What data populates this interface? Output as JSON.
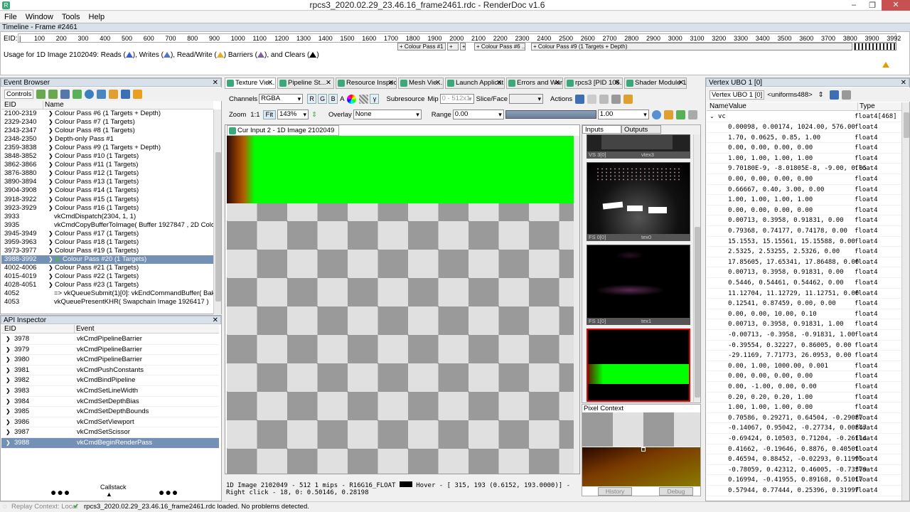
{
  "window": {
    "title": "rpcs3_2020.02.29_23.46.16_frame2461.rdc - RenderDoc v1.6",
    "min": "–",
    "max": "❐",
    "close": "✕"
  },
  "menu": [
    "File",
    "Window",
    "Tools",
    "Help"
  ],
  "timeline": {
    "title": "Timeline - Frame #2461",
    "eid_label": "EID:",
    "ticks": [
      "100",
      "200",
      "300",
      "400",
      "500",
      "600",
      "700",
      "800",
      "900",
      "1000",
      "1100",
      "1200",
      "1300",
      "1400",
      "1500",
      "1600",
      "1700",
      "1800",
      "1900",
      "2000",
      "2100",
      "2200",
      "2300",
      "2400",
      "2500",
      "2600",
      "2700",
      "2800",
      "2900",
      "3000",
      "3100",
      "3200",
      "3300",
      "3400",
      "3500",
      "3600",
      "3700",
      "3800",
      "3900",
      "3992"
    ],
    "passes": [
      "+ Colour Pass #1 ...",
      "+",
      "+",
      "+ Colour Pass #6 ...",
      "+ Colour Pass #9 (1 Targets + Depth)"
    ],
    "usage": {
      "prefix": "Usage for 1D Image 2102049: Reads (",
      "writes": "), Writes (",
      "rw": "), Read/Write (",
      "barriers": ") Barriers (",
      "clears": "), and Clears (",
      "end": ")"
    }
  },
  "event_browser": {
    "title": "Event Browser",
    "controls": "Controls",
    "col_eid": "EID",
    "col_name": "Name",
    "rows": [
      {
        "eid": "2100-2319",
        "name": "Colour Pass #6 (1 Targets + Depth)",
        "arrow": true
      },
      {
        "eid": "2329-2340",
        "name": "Colour Pass #7 (1 Targets)",
        "arrow": true
      },
      {
        "eid": "2343-2347",
        "name": "Colour Pass #8 (1 Targets)",
        "arrow": true
      },
      {
        "eid": "2348-2350",
        "name": "Depth-only Pass #1",
        "arrow": true
      },
      {
        "eid": "2359-3838",
        "name": "Colour Pass #9 (1 Targets + Depth)",
        "arrow": true
      },
      {
        "eid": "3848-3852",
        "name": "Colour Pass #10 (1 Targets)",
        "arrow": true
      },
      {
        "eid": "3862-3866",
        "name": "Colour Pass #11 (1 Targets)",
        "arrow": true
      },
      {
        "eid": "3876-3880",
        "name": "Colour Pass #12 (1 Targets)",
        "arrow": true
      },
      {
        "eid": "3890-3894",
        "name": "Colour Pass #13 (1 Targets)",
        "arrow": true
      },
      {
        "eid": "3904-3908",
        "name": "Colour Pass #14 (1 Targets)",
        "arrow": true
      },
      {
        "eid": "3918-3922",
        "name": "Colour Pass #15 (1 Targets)",
        "arrow": true
      },
      {
        "eid": "3923-3929",
        "name": "Colour Pass #16 (1 Targets)",
        "arrow": true
      },
      {
        "eid": "3933",
        "name": "vkCmdDispatch(2304, 1, 1)",
        "arrow": false
      },
      {
        "eid": "3935",
        "name": "vkCmdCopyBufferToImage( Buffer 1927847 , 2D Color Att",
        "arrow": false
      },
      {
        "eid": "3945-3949",
        "name": "Colour Pass #17 (1 Targets)",
        "arrow": true
      },
      {
        "eid": "3959-3963",
        "name": "Colour Pass #18 (1 Targets)",
        "arrow": true
      },
      {
        "eid": "3973-3977",
        "name": "Colour Pass #19 (1 Targets)",
        "arrow": true
      },
      {
        "eid": "3988-3992",
        "name": "Colour Pass #20 (1 Targets)",
        "arrow": true,
        "selected": true
      },
      {
        "eid": "4002-4006",
        "name": "Colour Pass #21 (1 Targets)",
        "arrow": true
      },
      {
        "eid": "4015-4019",
        "name": "Colour Pass #22 (1 Targets)",
        "arrow": true
      },
      {
        "eid": "4028-4051",
        "name": "Colour Pass #23 (1 Targets)",
        "arrow": true
      },
      {
        "eid": "4052",
        "name": "=> vkQueueSubmit(1)[0]: vkEndCommandBuffer( Baked Comm",
        "arrow": false
      },
      {
        "eid": "4053",
        "name": "vkQueuePresentKHR( Swapchain Image 1926417 )",
        "arrow": false
      }
    ]
  },
  "api_inspector": {
    "title": "API Inspector",
    "col_eid": "EID",
    "col_event": "Event",
    "callstack": "Callstack",
    "rows": [
      {
        "eid": "3978",
        "event": "vkCmdPipelineBarrier"
      },
      {
        "eid": "3979",
        "event": "vkCmdPipelineBarrier"
      },
      {
        "eid": "3980",
        "event": "vkCmdPipelineBarrier"
      },
      {
        "eid": "3981",
        "event": "vkCmdPushConstants"
      },
      {
        "eid": "3982",
        "event": "vkCmdBindPipeline"
      },
      {
        "eid": "3983",
        "event": "vkCmdSetLineWidth"
      },
      {
        "eid": "3984",
        "event": "vkCmdSetDepthBias"
      },
      {
        "eid": "3985",
        "event": "vkCmdSetDepthBounds"
      },
      {
        "eid": "3986",
        "event": "vkCmdSetViewport"
      },
      {
        "eid": "3987",
        "event": "vkCmdSetScissor"
      },
      {
        "eid": "3988",
        "event": "vkCmdBeginRenderPass",
        "selected": true
      }
    ]
  },
  "tabs": [
    "Texture Vie...",
    "Pipeline St...",
    "Resource Inspec...",
    "Mesh Vie...",
    "Launch Applicat...",
    "Errors and Warni...",
    "rpcs3 [PID 105...",
    "Shader Module 1927..."
  ],
  "texture_viewer": {
    "channels_label": "Channels",
    "channels_value": "RGBA",
    "r": "R",
    "g": "G",
    "b": "B",
    "a": "A",
    "subresource": "Subresource",
    "mip_label": "Mip",
    "mip_value": "0 - 512x1",
    "slice_label": "Slice/Face",
    "actions": "Actions",
    "zoom_label": "Zoom",
    "zoom_11": "1:1",
    "fit": "Fit",
    "zoom_value": "143%",
    "overlay_label": "Overlay",
    "overlay_value": "None",
    "range_label": "Range",
    "range_min": "0.00",
    "range_max": "1.00",
    "view_tab": "Cur Input 2 - 1D Image 2102049",
    "status1": "1D Image 2102049 - 512 1 mips - R16G16_FLOAT",
    "status1b": "Hover - [ 315,  193 (0.6152, 193.0000)] -",
    "status2": "Right click -   18,    0: 0.50146, 0.28198",
    "inputs": "Inputs",
    "outputs": "Outputs",
    "thumbs": [
      {
        "left": "VS 3[0]",
        "right": "vtex3"
      },
      {
        "left": "FS 0[0]",
        "right": "tex0"
      },
      {
        "left": "FS 1[0]",
        "right": "tex1"
      }
    ],
    "pixel_context": "Pixel Context",
    "history": "History",
    "debug": "Debug"
  },
  "ubo": {
    "title": "Vertex UBO 1 [0]",
    "tab_label": "Vertex UBO 1 [0]",
    "uniforms": "<uniforms488>",
    "col_name": "Name",
    "col_value": "Value",
    "col_type": "Type",
    "root": {
      "name": "vc",
      "type": "float4[468]"
    },
    "rows": [
      [
        "0.00098, 0.00174, 1024.00, 576.00",
        "float4"
      ],
      [
        "1.70, 0.0625, 0.85, 1.00",
        "float4"
      ],
      [
        "0.00, 0.00, 0.00, 0.00",
        "float4"
      ],
      [
        "1.00, 1.00, 1.00, 1.00",
        "float4"
      ],
      [
        "9.70180E-9, -8.01805E-8, -9.00, 0.05",
        "float4"
      ],
      [
        "0.00, 0.00, 0.00, 0.00",
        "float4"
      ],
      [
        "0.66667, 0.40, 3.00, 0.00",
        "float4"
      ],
      [
        "1.00, 1.00, 1.00, 1.00",
        "float4"
      ],
      [
        "0.00, 0.00, 0.00, 0.00",
        "float4"
      ],
      [
        "0.00713, 0.3958, 0.91831, 0.00",
        "float4"
      ],
      [
        "0.79368, 0.74177, 0.74178, 0.00",
        "float4"
      ],
      [
        "15.1553, 15.15561, 15.15588, 0.00",
        "float4"
      ],
      [
        "2.5325, 2.53255, 2.5326, 0.00",
        "float4"
      ],
      [
        "17.85605, 17.65341, 17.86488, 0.00",
        "float4"
      ],
      [
        "0.00713, 0.3958, 0.91831, 0.00",
        "float4"
      ],
      [
        "0.5446, 0.54461, 0.54462, 0.00",
        "float4"
      ],
      [
        "11.12704, 11.12729, 11.12751, 0.00",
        "float4"
      ],
      [
        "0.12541, 0.87459, 0.00, 0.00",
        "float4"
      ],
      [
        "0.00, 0.00, 10.00, 0.10",
        "float4"
      ],
      [
        "0.00713, 0.3958, 0.91831, 1.00",
        "float4"
      ],
      [
        "-0.00713, -0.3958, -0.91831, 1.00",
        "float4"
      ],
      [
        "-0.39554, 0.32227, 0.86005, 0.00",
        "float4"
      ],
      [
        "-29.1169, 7.71773, 26.0953, 0.00",
        "float4"
      ],
      [
        "0.00, 1.00, 1000.00, 0.001",
        "float4"
      ],
      [
        "0.00, 0.00, 0.00, 0.00",
        "float4"
      ],
      [
        "0.00, -1.00, 0.00, 0.00",
        "float4"
      ],
      [
        "0.20, 0.20, 0.20, 1.00",
        "float4"
      ],
      [
        "1.00, 1.00, 1.00, 0.00",
        "float4"
      ],
      [
        "0.70586, 0.29271, 0.64504, -0.29087",
        "float4"
      ],
      [
        "-0.14067, 0.95042, -0.27734, 0.00847",
        "float4"
      ],
      [
        "-0.69424, 0.10503, 0.71204, -0.26114",
        "float4"
      ],
      [
        "0.41662, -0.19646, 0.8876, 0.40501",
        "float4"
      ],
      [
        "0.46594, 0.88452, -0.02293, 0.11995",
        "float4"
      ],
      [
        "-0.78059, 0.42312, 0.46005, -0.73379",
        "float4"
      ],
      [
        "0.16994, -0.41955, 0.89168, 0.51017",
        "float4"
      ],
      [
        "0.57944, 0.77444, 0.25396, 0.31997",
        "float4"
      ]
    ]
  },
  "statusbar": {
    "replay": "Replay Context: Local",
    "message": "rpcs3_2020.02.29_23.46.16_frame2461.rdc loaded. No problems detected."
  }
}
